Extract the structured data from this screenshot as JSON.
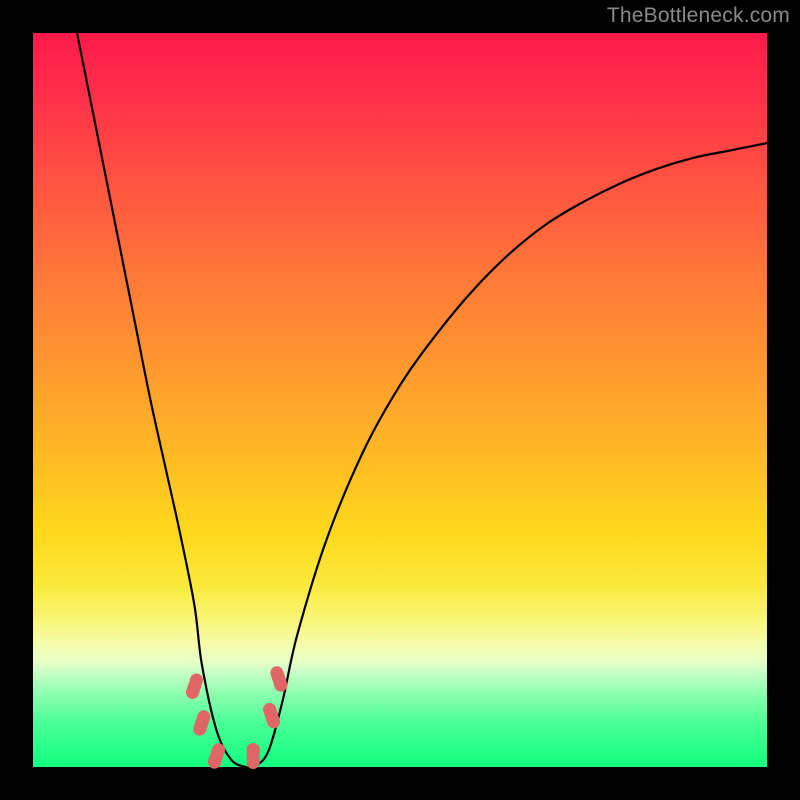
{
  "watermark": "TheBottleneck.com",
  "colors": {
    "frame": "#000000",
    "gradient_top": "#ff1a4b",
    "gradient_bottom": "#12ff7e",
    "curve": "#000000",
    "marker": "#e06666",
    "watermark_text": "#8a8a8a"
  },
  "chart_data": {
    "type": "line",
    "title": "",
    "xlabel": "",
    "ylabel": "",
    "xlim": [
      0,
      100
    ],
    "ylim": [
      0,
      100
    ],
    "grid": false,
    "legend": false,
    "note": "Bottleneck-style curve: a single black V-shaped curve over a vertical rainbow heat gradient. Values below are estimated (x = horizontal %, y = vertical % with 0 at bottom). Minimum (~0) occurs roughly around x≈25–30.",
    "series": [
      {
        "name": "curve",
        "x": [
          6,
          8,
          10,
          12,
          14,
          16,
          18,
          20,
          22,
          23,
          25,
          27,
          29,
          30,
          32,
          34,
          36,
          40,
          45,
          50,
          55,
          60,
          65,
          70,
          75,
          80,
          85,
          90,
          95,
          100
        ],
        "y": [
          100,
          90,
          80,
          70,
          60,
          50,
          41,
          32,
          22,
          14,
          5,
          1,
          0,
          0,
          2,
          9,
          18,
          31,
          43,
          52,
          59,
          65,
          70,
          74,
          77,
          79.5,
          81.5,
          83,
          84,
          85
        ]
      }
    ],
    "markers": [
      {
        "x": 22.0,
        "y": 11.0,
        "shape": "rounded-pill"
      },
      {
        "x": 23.0,
        "y": 6.0,
        "shape": "rounded-pill"
      },
      {
        "x": 25.0,
        "y": 1.5,
        "shape": "rounded-pill"
      },
      {
        "x": 30.0,
        "y": 1.5,
        "shape": "rounded-pill"
      },
      {
        "x": 32.5,
        "y": 7.0,
        "shape": "rounded-pill"
      },
      {
        "x": 33.5,
        "y": 12.0,
        "shape": "rounded-pill"
      }
    ]
  }
}
